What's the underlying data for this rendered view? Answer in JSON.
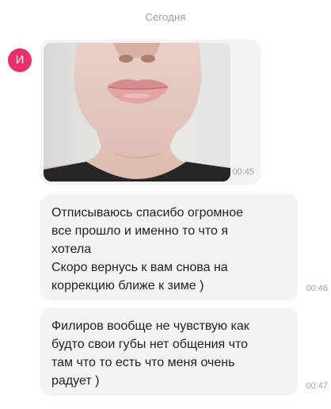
{
  "chat": {
    "date_divider": "Сегодня",
    "contact_initial": "И",
    "colors": {
      "avatar": "#e8306a",
      "bubble": "#f2f3f5",
      "time": "#a4a4a4"
    },
    "messages": [
      {
        "type": "photo",
        "time": "00:45"
      },
      {
        "type": "text",
        "text": "Отписываюсь спасибо огромное\nвсе прошло и именно то что я\nхотела\nСкоро вернусь к вам снова на\nкоррекцию ближе к зиме )",
        "time": "00:46"
      },
      {
        "type": "text",
        "text": "Филиров вообще не чувствую как\nбудто свои губы нет общения что\nтам что то есть что меня очень\nрадует )",
        "time": "00:47"
      }
    ]
  }
}
